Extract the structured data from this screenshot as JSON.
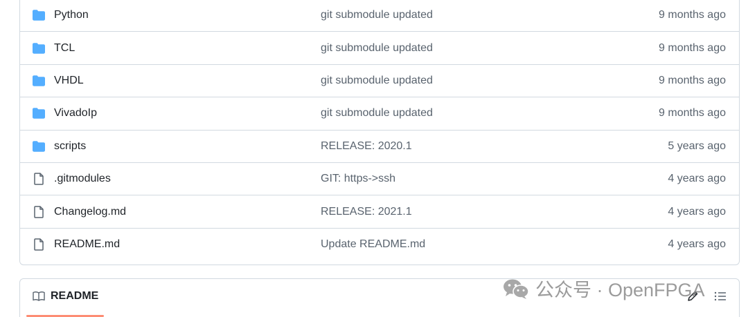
{
  "colors": {
    "folder_icon": "#54aeff",
    "file_icon": "#59636e",
    "border": "#d1d9e0",
    "muted_text": "#59636e",
    "readme_underline": "#fd8c73"
  },
  "files": [
    {
      "icon": "folder-icon",
      "name": "Python",
      "commit": "git submodule updated",
      "date": "9 months ago"
    },
    {
      "icon": "folder-icon",
      "name": "TCL",
      "commit": "git submodule updated",
      "date": "9 months ago"
    },
    {
      "icon": "folder-icon",
      "name": "VHDL",
      "commit": "git submodule updated",
      "date": "9 months ago"
    },
    {
      "icon": "folder-icon",
      "name": "VivadoIp",
      "commit": "git submodule updated",
      "date": "9 months ago"
    },
    {
      "icon": "folder-icon",
      "name": "scripts",
      "commit": "RELEASE: 2020.1",
      "date": "5 years ago"
    },
    {
      "icon": "file-icon",
      "name": ".gitmodules",
      "commit": "GIT: https->ssh",
      "date": "4 years ago"
    },
    {
      "icon": "file-icon",
      "name": "Changelog.md",
      "commit": "RELEASE: 2021.1",
      "date": "4 years ago"
    },
    {
      "icon": "file-icon",
      "name": "README.md",
      "commit": "Update README.md",
      "date": "4 years ago"
    }
  ],
  "readme": {
    "tab_label": "README",
    "tab_icon": "book-icon",
    "edit_icon": "pencil-icon",
    "outline_icon": "list-icon"
  },
  "watermark": {
    "text": "公众号 · OpenFPGA",
    "icon": "wechat-icon"
  }
}
